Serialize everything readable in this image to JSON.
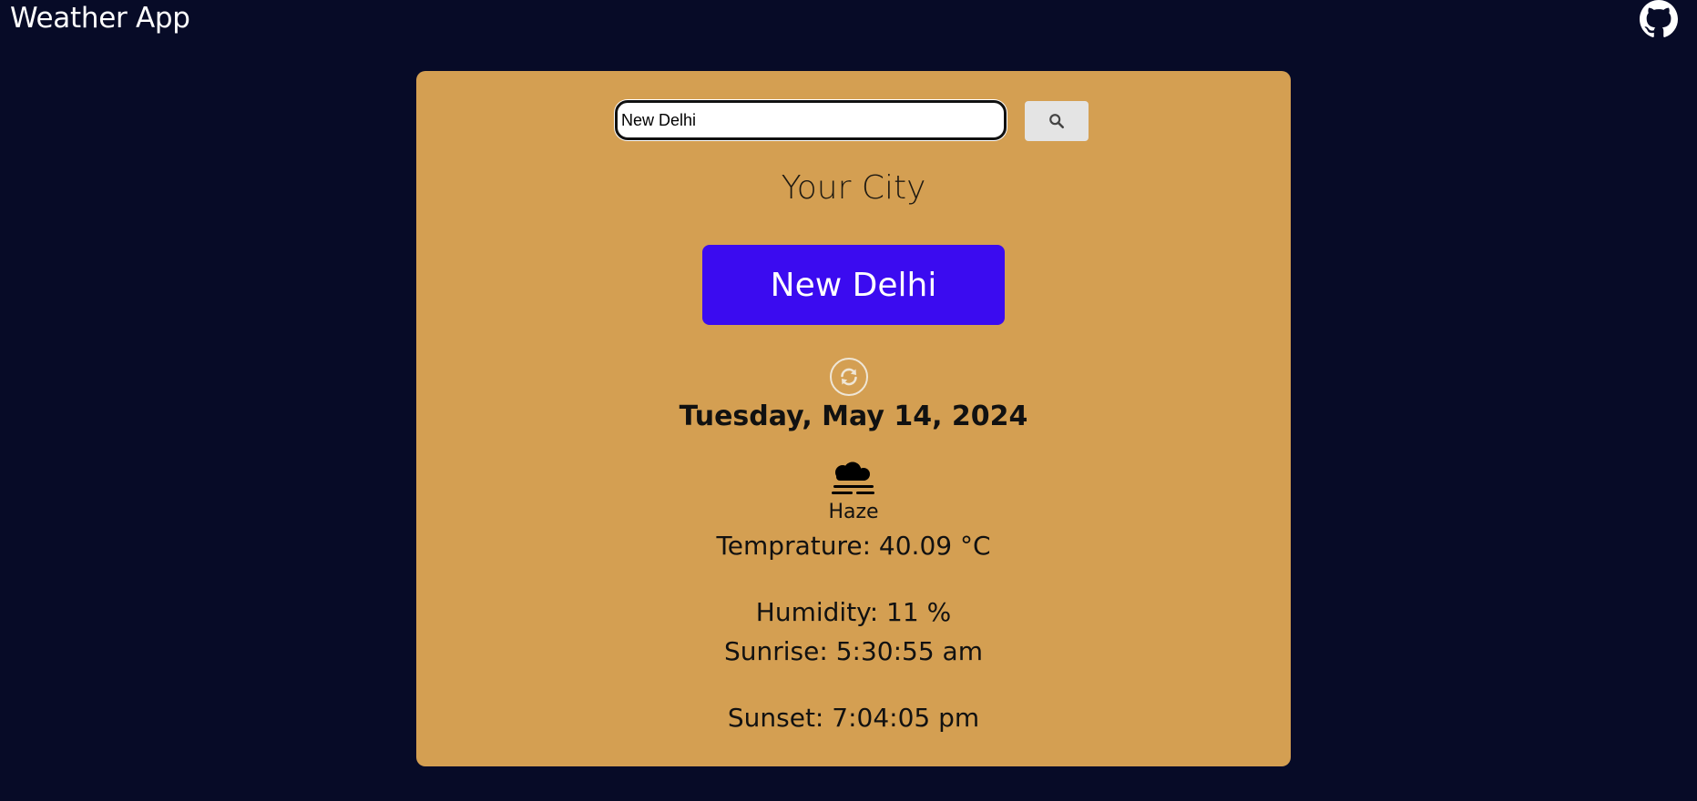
{
  "app": {
    "title": "Weather App"
  },
  "header": {
    "github_icon": "github-icon"
  },
  "search": {
    "value": "New Delhi",
    "button_icon": "search-icon"
  },
  "card": {
    "heading": "Your City",
    "city_name": "New Delhi",
    "refresh_icon": "refresh-icon",
    "date": "Tuesday, May 14, 2024",
    "condition_icon": "haze-icon",
    "condition": "Haze",
    "temperature": "Temprature: 40.09 °C",
    "humidity": "Humidity: 11 %",
    "sunrise": "Sunrise: 5:30:55 am",
    "sunset": "Sunset: 7:04:05 pm"
  },
  "colors": {
    "background": "#070b27",
    "card": "#d49f52",
    "city_button": "#3b0bf0"
  }
}
